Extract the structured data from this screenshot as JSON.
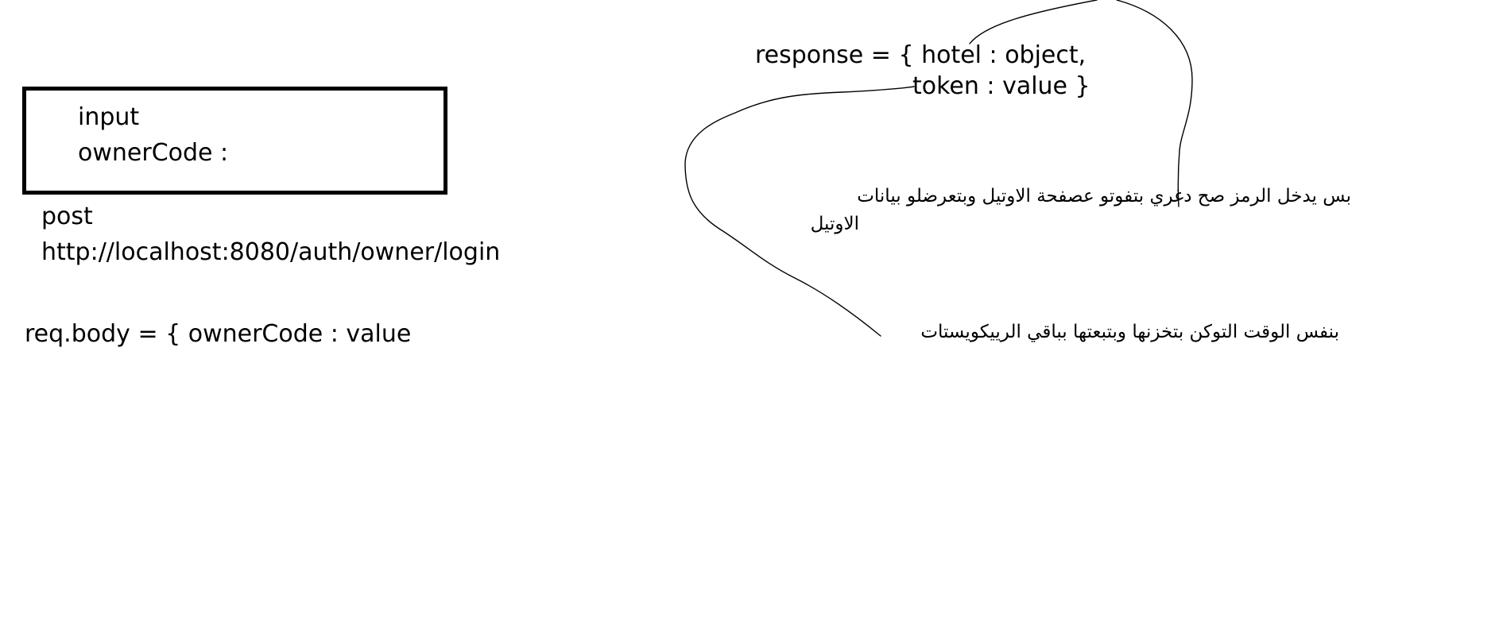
{
  "input_box": {
    "title": "input",
    "field_label": "ownerCode :"
  },
  "request": {
    "method": "post",
    "url": "http://localhost:8080/auth/owner/login",
    "body": "req.body = { ownerCode : value"
  },
  "response": {
    "line1": "response = { hotel : object,",
    "line2": "token : value }"
  },
  "notes": {
    "note1_line1": "بس يدخل الرمز صح دغري بتفوتو عصفحة الاوتيل وبتعرضلو بيانات",
    "note1_line2": "الاوتيل",
    "note2": "بنفس الوقت التوكن بتخزنها وبتبعتها بباقي الرييكويستات"
  },
  "colors": {
    "ink": "#000000",
    "background": "#ffffff"
  }
}
